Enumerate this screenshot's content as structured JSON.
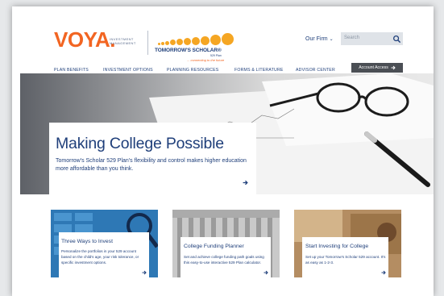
{
  "brand": {
    "voya": "VOYA.",
    "voya_sub_1": "INVESTMENT",
    "voya_sub_2": "MANAGEMENT",
    "ts_name": "TOMORROW'S SCHOLAR®",
    "ts_529": "529 Plan",
    "ts_tagline": "... connecting to the future"
  },
  "header": {
    "our_firm": "Our Firm",
    "search_placeholder": "Search"
  },
  "nav": {
    "items": [
      "PLAN BENEFITS",
      "INVESTMENT OPTIONS",
      "PLANNING RESOURCES",
      "FORMS & LITERATURE",
      "ADVISOR CENTER"
    ],
    "account_access": "Account Access"
  },
  "hero": {
    "title": "Making College Possible",
    "text": "Tomorrow's Scholar 529 Plan's flexibility and control makes higher education more affordable than you think."
  },
  "cards": [
    {
      "title": "Three Ways to Invest",
      "text": "Personalize the portfolios in your 529 account based on the child's age, your risk tolerance, or specific investment options."
    },
    {
      "title": "College Funding Planner",
      "text": "Set and achieve college funding path goals using this easy-to-use interactive 529 Plan calculator."
    },
    {
      "title": "Start Investing for College",
      "text": "Set up your Tomorrow's Scholar 529 account. It's as easy as 1-2-3."
    }
  ],
  "colors": {
    "brand_orange": "#f26522",
    "navy": "#1f3f7a",
    "dot_orange": "#f5a623",
    "account_button": "#4b4f55"
  },
  "icons": [
    "search-icon",
    "chevron-down-icon",
    "arrow-right-icon"
  ]
}
